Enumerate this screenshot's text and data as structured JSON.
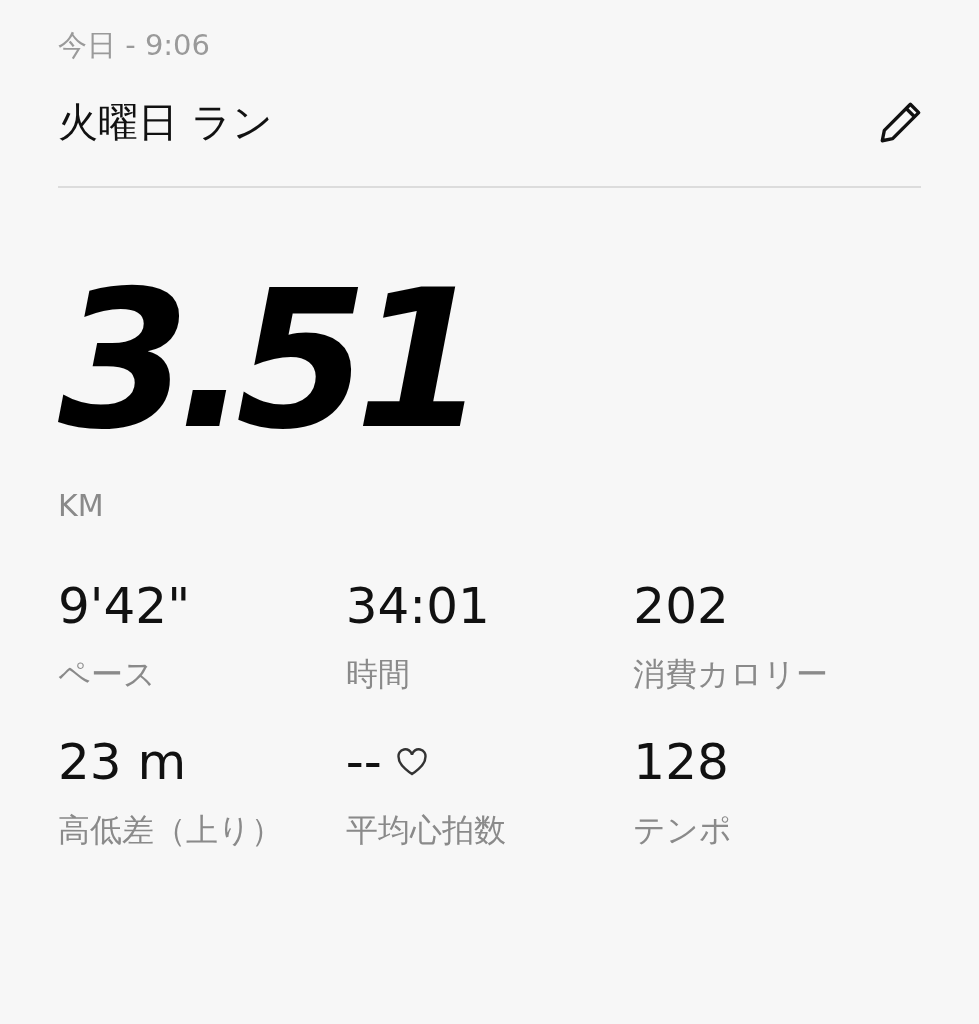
{
  "header": {
    "date": "今日 - 9:06",
    "title": "火曜日 ラン"
  },
  "distance": {
    "value": "3.51",
    "unit": "KM"
  },
  "stats": [
    {
      "kind": "plain",
      "value": "9'42\"",
      "label": "ペース"
    },
    {
      "kind": "plain",
      "value": "34:01",
      "label": "時間"
    },
    {
      "kind": "plain",
      "value": "202",
      "label": "消費カロリー"
    },
    {
      "kind": "plain",
      "value": "23 m",
      "label": "高低差（上り）"
    },
    {
      "kind": "heart_rate",
      "value": "--",
      "label": "平均心拍数"
    },
    {
      "kind": "plain",
      "value": "128",
      "label": "テンポ"
    }
  ]
}
